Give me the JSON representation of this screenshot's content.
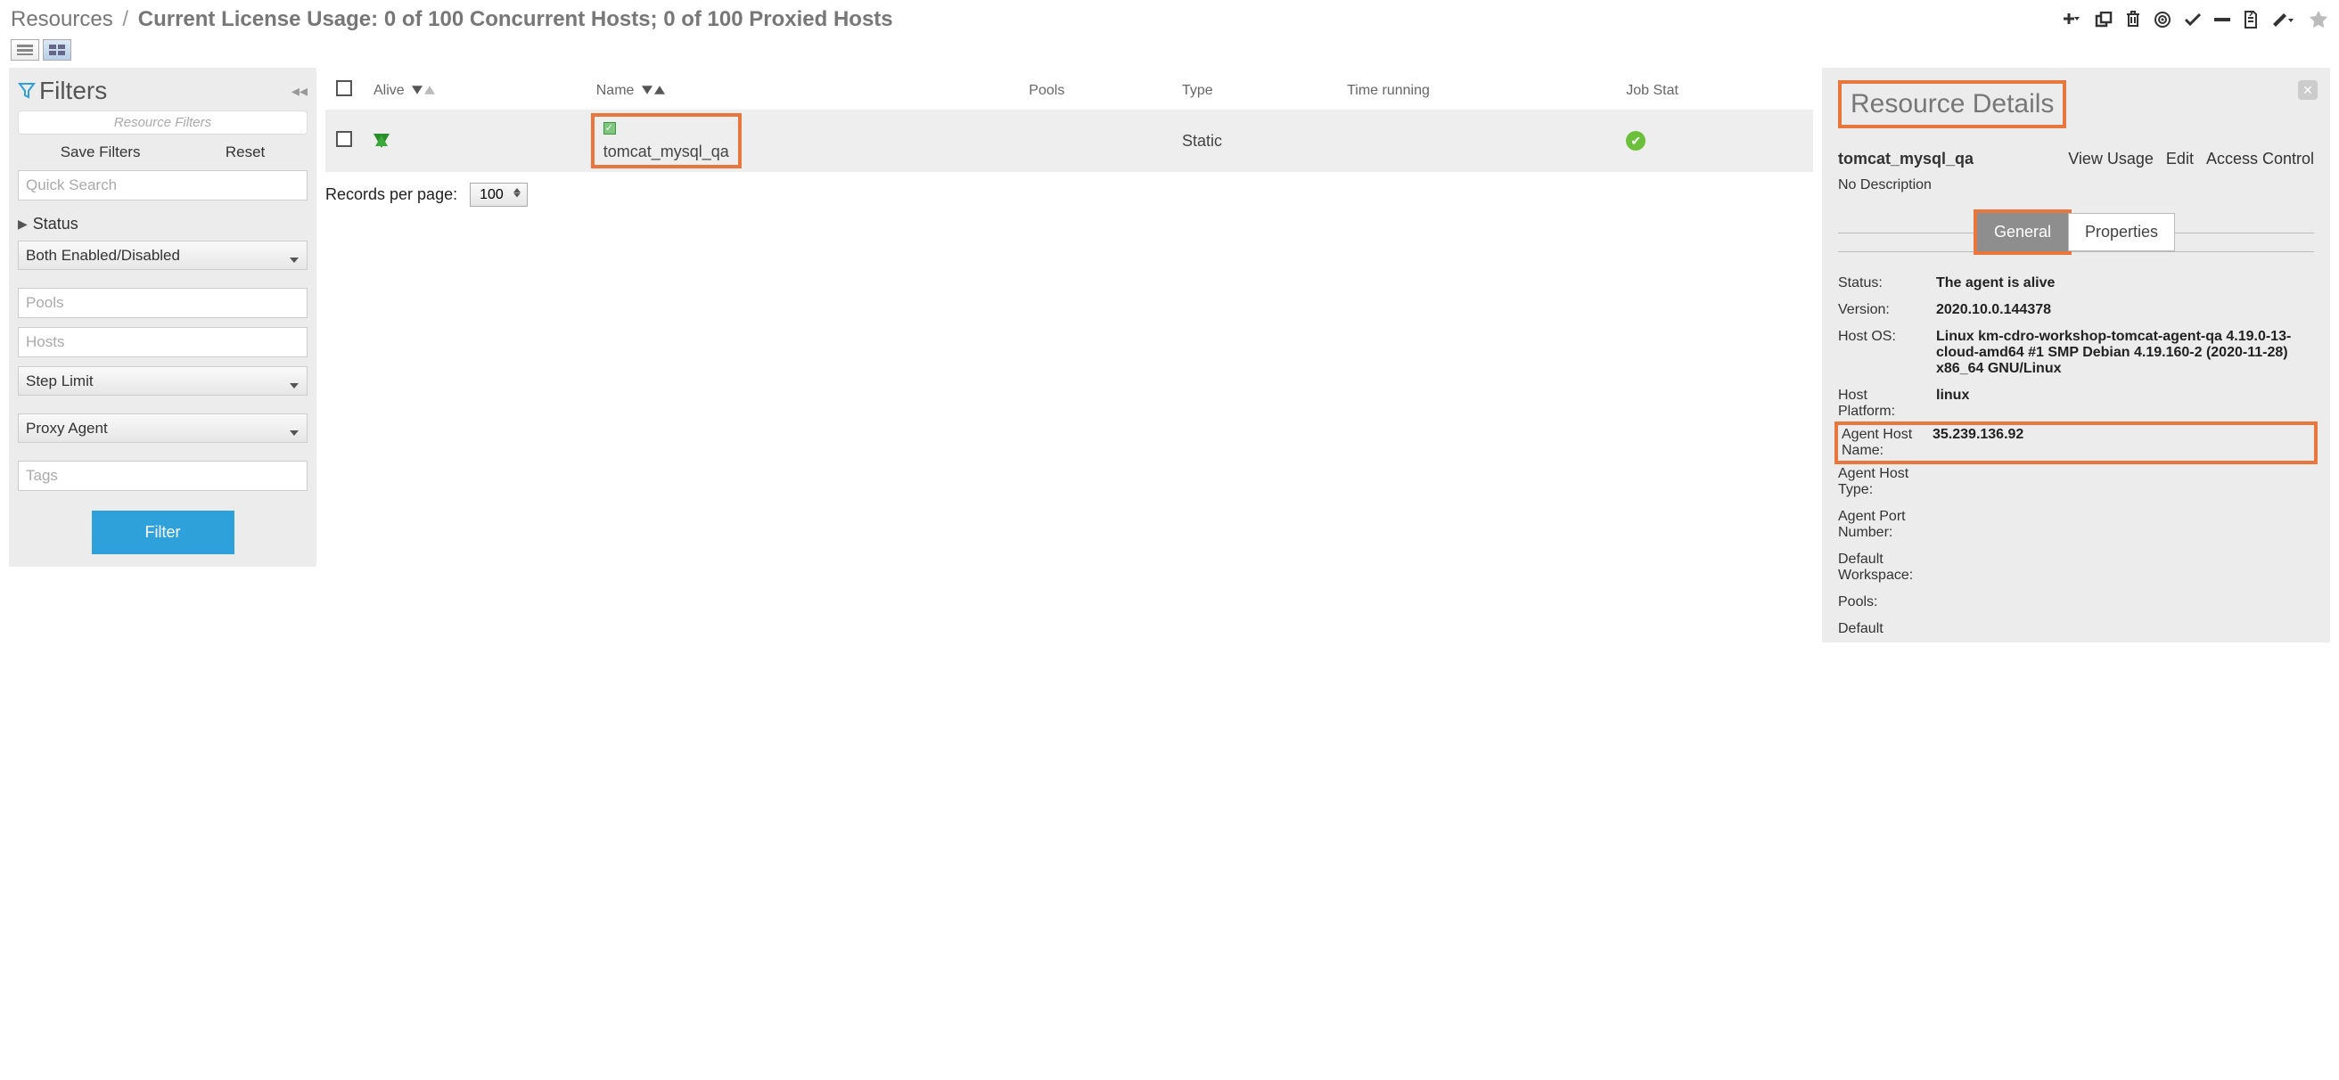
{
  "breadcrumb": {
    "root": "Resources",
    "title": "Current License Usage: 0 of 100 Concurrent Hosts; 0 of 100 Proxied Hosts"
  },
  "filters": {
    "title": "Filters",
    "placeholder_bar": "Resource Filters",
    "save": "Save Filters",
    "reset": "Reset",
    "quick_search_ph": "Quick Search",
    "status_label": "Status",
    "enabled_select": "Both Enabled/Disabled",
    "pools_ph": "Pools",
    "hosts_ph": "Hosts",
    "step_limit": "Step Limit",
    "proxy_agent": "Proxy Agent",
    "tags_ph": "Tags",
    "filter_btn": "Filter"
  },
  "table": {
    "columns": {
      "alive": "Alive",
      "name": "Name",
      "pools": "Pools",
      "type": "Type",
      "time_running": "Time running",
      "job_status": "Job Stat"
    },
    "row": {
      "name": "tomcat_mysql_qa",
      "type": "Static"
    },
    "records_label": "Records per page:",
    "records_value": "100"
  },
  "details": {
    "title": "Resource Details",
    "name": "tomcat_mysql_qa",
    "links": {
      "usage": "View Usage",
      "edit": "Edit",
      "access": "Access Control"
    },
    "description": "No Description",
    "tabs": {
      "general": "General",
      "properties": "Properties"
    },
    "props": {
      "status_l": "Status:",
      "status_v": "The agent is alive",
      "version_l": "Version:",
      "version_v": "2020.10.0.144378",
      "hostos_l": "Host OS:",
      "hostos_v": "Linux km-cdro-workshop-tomcat-agent-qa 4.19.0-13-cloud-amd64 #1 SMP Debian 4.19.160-2 (2020-11-28) x86_64 GNU/Linux",
      "platform_l": "Host Platform:",
      "platform_v": "linux",
      "hostname_l": "Agent Host Name:",
      "hostname_v": "35.239.136.92",
      "hosttype_l": "Agent Host Type:",
      "port_l": "Agent Port Number:",
      "ws_l": "Default Workspace:",
      "pools_l": "Pools:",
      "default_l": "Default"
    }
  }
}
